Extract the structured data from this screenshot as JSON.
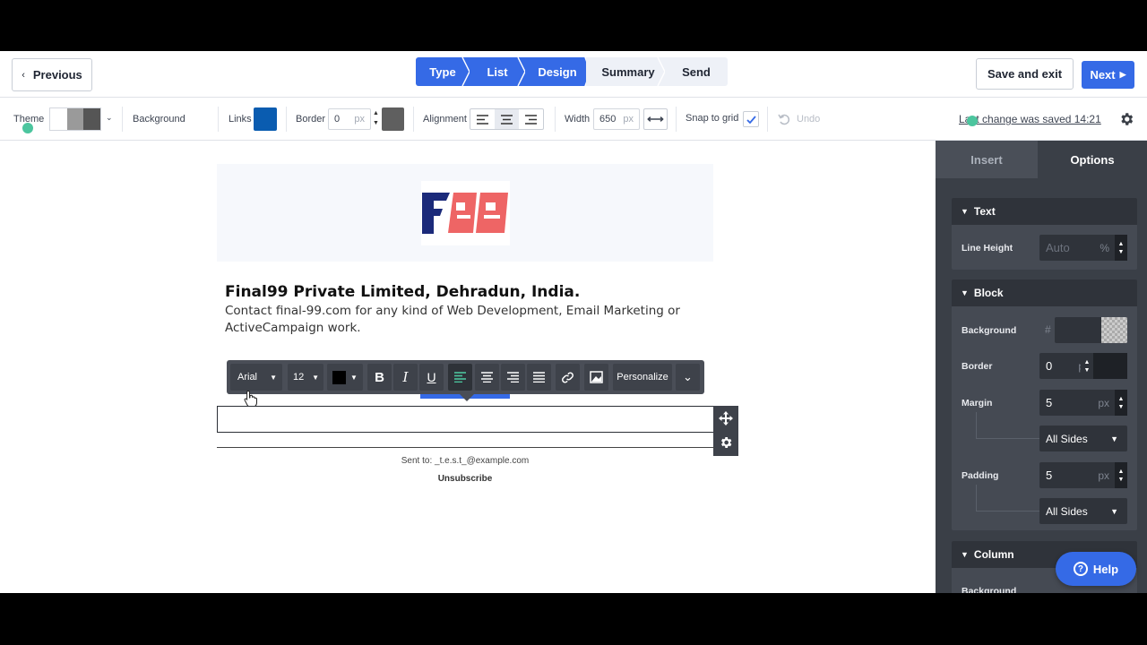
{
  "header": {
    "previous_label": "Previous",
    "steps": [
      "Type",
      "List",
      "Design",
      "Summary",
      "Send"
    ],
    "save_exit_label": "Save and exit",
    "next_label": "Next"
  },
  "toolbar": {
    "theme_label": "Theme",
    "background_label": "Background",
    "links_label": "Links",
    "links_color": "#0a5cb0",
    "border_label": "Border",
    "border_value": "0",
    "border_unit": "px",
    "alignment_label": "Alignment",
    "width_label": "Width",
    "width_value": "650",
    "width_unit": "px",
    "snap_label": "Snap to grid",
    "undo_label": "Undo",
    "saved_text": "Last change was saved 14:21"
  },
  "email": {
    "heading": "Final99 Private Limited, Dehradun, India.",
    "body": "Contact final-99.com for any kind of Web Development, Email Marketing or ActiveCampaign work.",
    "sent_to": "Sent to: _t.e.s.t_@example.com",
    "unsubscribe": "Unsubscribe"
  },
  "format_bar": {
    "font": "Arial",
    "size": "12",
    "personalize_label": "Personalize"
  },
  "panel": {
    "tab_insert": "Insert",
    "tab_options": "Options",
    "text_section": "Text",
    "line_height_label": "Line Height",
    "line_height_placeholder": "Auto",
    "line_height_unit": "%",
    "block_section": "Block",
    "background_label": "Background",
    "hash": "#",
    "border_label": "Border",
    "border_value": "0",
    "border_unit": "px",
    "margin_label": "Margin",
    "margin_value": "5",
    "margin_unit": "px",
    "margin_sides": "All Sides",
    "padding_label": "Padding",
    "padding_value": "5",
    "padding_unit": "px",
    "padding_sides": "All Sides",
    "column_section": "Column",
    "column_background_label": "Background"
  },
  "help_label": "Help",
  "colors": {
    "accent": "#356ae6",
    "panel": "#3a3f47",
    "cursor_dot": "#4cc59e"
  }
}
